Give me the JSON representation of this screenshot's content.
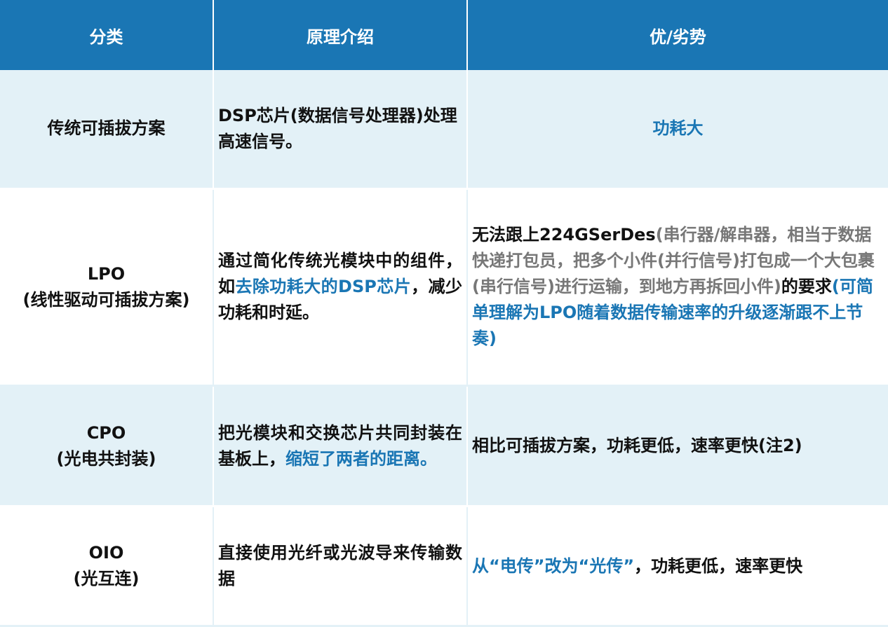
{
  "header": {
    "col1": "分类",
    "col2": "原理介绍",
    "col3": "优/劣势"
  },
  "rows": [
    {
      "category": "传统可插拔方案",
      "principle": "DSP芯片(数据信号处理器)处理高速信号。",
      "pros_cons": "功耗大"
    },
    {
      "category_line1": "LPO",
      "category_line2": "(线性驱动可插拔方案)",
      "principle_a": "通过简化传统光模块中的组件，如",
      "principle_b": "去除功耗大的DSP芯片",
      "principle_c": "，减少功耗和时延。",
      "pros_cons_a": "无法跟上224GSerDes",
      "pros_cons_b": "(串行器/解串器，相当于数据快递打包员，把多个小件(并行信号)打包成一个大包裹(串行信号)进行运输，到地方再拆回小件)",
      "pros_cons_c": "的要求",
      "pros_cons_d": "(可简单理解为LPO随着数据传输速率的升级逐渐跟不上节奏)"
    },
    {
      "category_line1": "CPO",
      "category_line2": "(光电共封装)",
      "principle_a": "把光模块和交换芯片共同封装在基板上，",
      "principle_b": "缩短了两者的距离。",
      "pros_cons": "相比可插拔方案，功耗更低，速率更快(注2)"
    },
    {
      "category_line1": "OIO",
      "category_line2": "(光互连)",
      "principle": "直接使用光纤或光波导来传输数据",
      "pros_cons_a": "从“电传”改为“光传”",
      "pros_cons_b": "，功耗更低，速率更快"
    }
  ],
  "colors": {
    "header_bg": "#1a76b4",
    "accent_blue": "#1a76b4",
    "row_tint": "#e3f1f7",
    "note_gray": "#777777"
  }
}
